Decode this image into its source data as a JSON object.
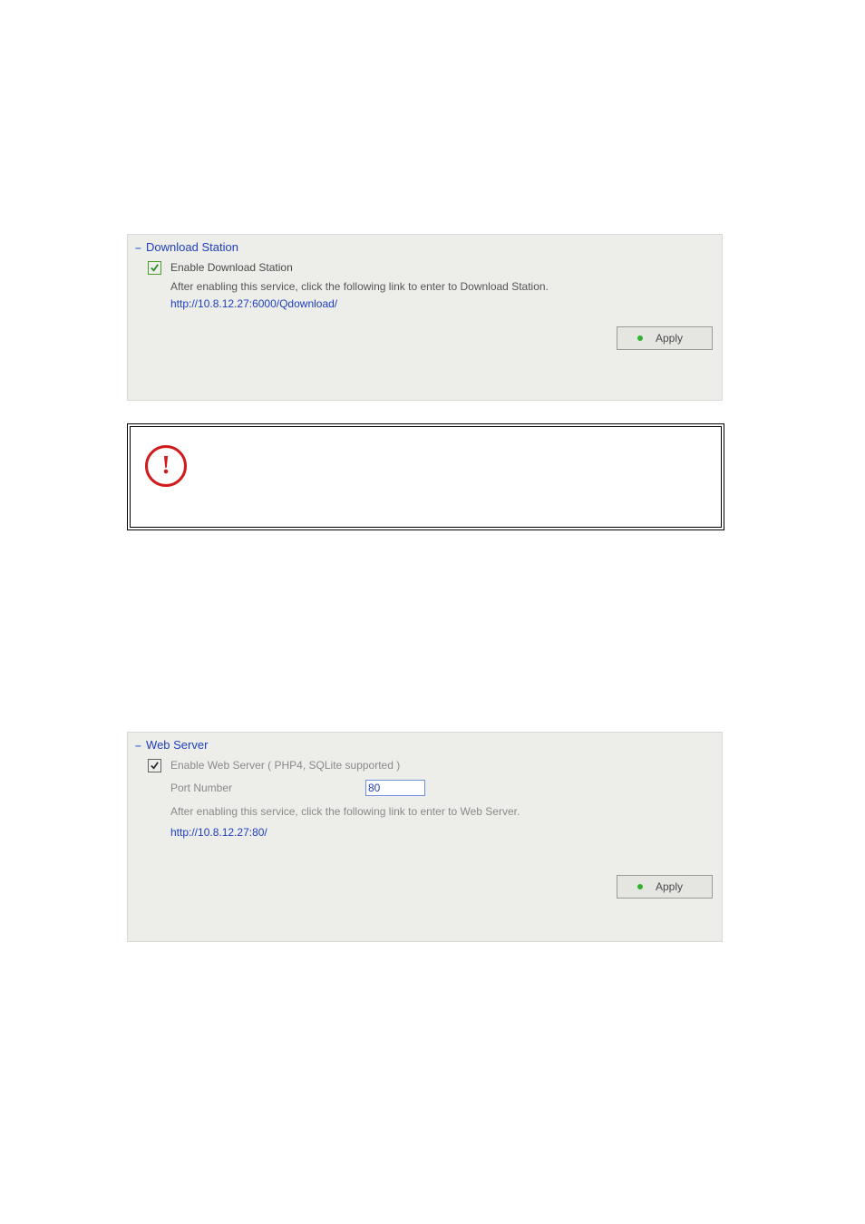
{
  "download_station": {
    "title": "Download Station",
    "checkbox_label": "Enable Download Station",
    "description": "After enabling this service, click the following link to enter to Download Station.",
    "link": "http://10.8.12.27:6000/Qdownload/",
    "apply_label": "Apply"
  },
  "web_server": {
    "title": "Web Server",
    "checkbox_label": "Enable Web Server   ( PHP4, SQLite supported )",
    "port_label": "Port Number",
    "port_value": "80",
    "description": "After enabling this service, click the following link to enter to Web Server.",
    "link": "http://10.8.12.27:80/",
    "apply_label": "Apply"
  },
  "warning_glyph": "!"
}
